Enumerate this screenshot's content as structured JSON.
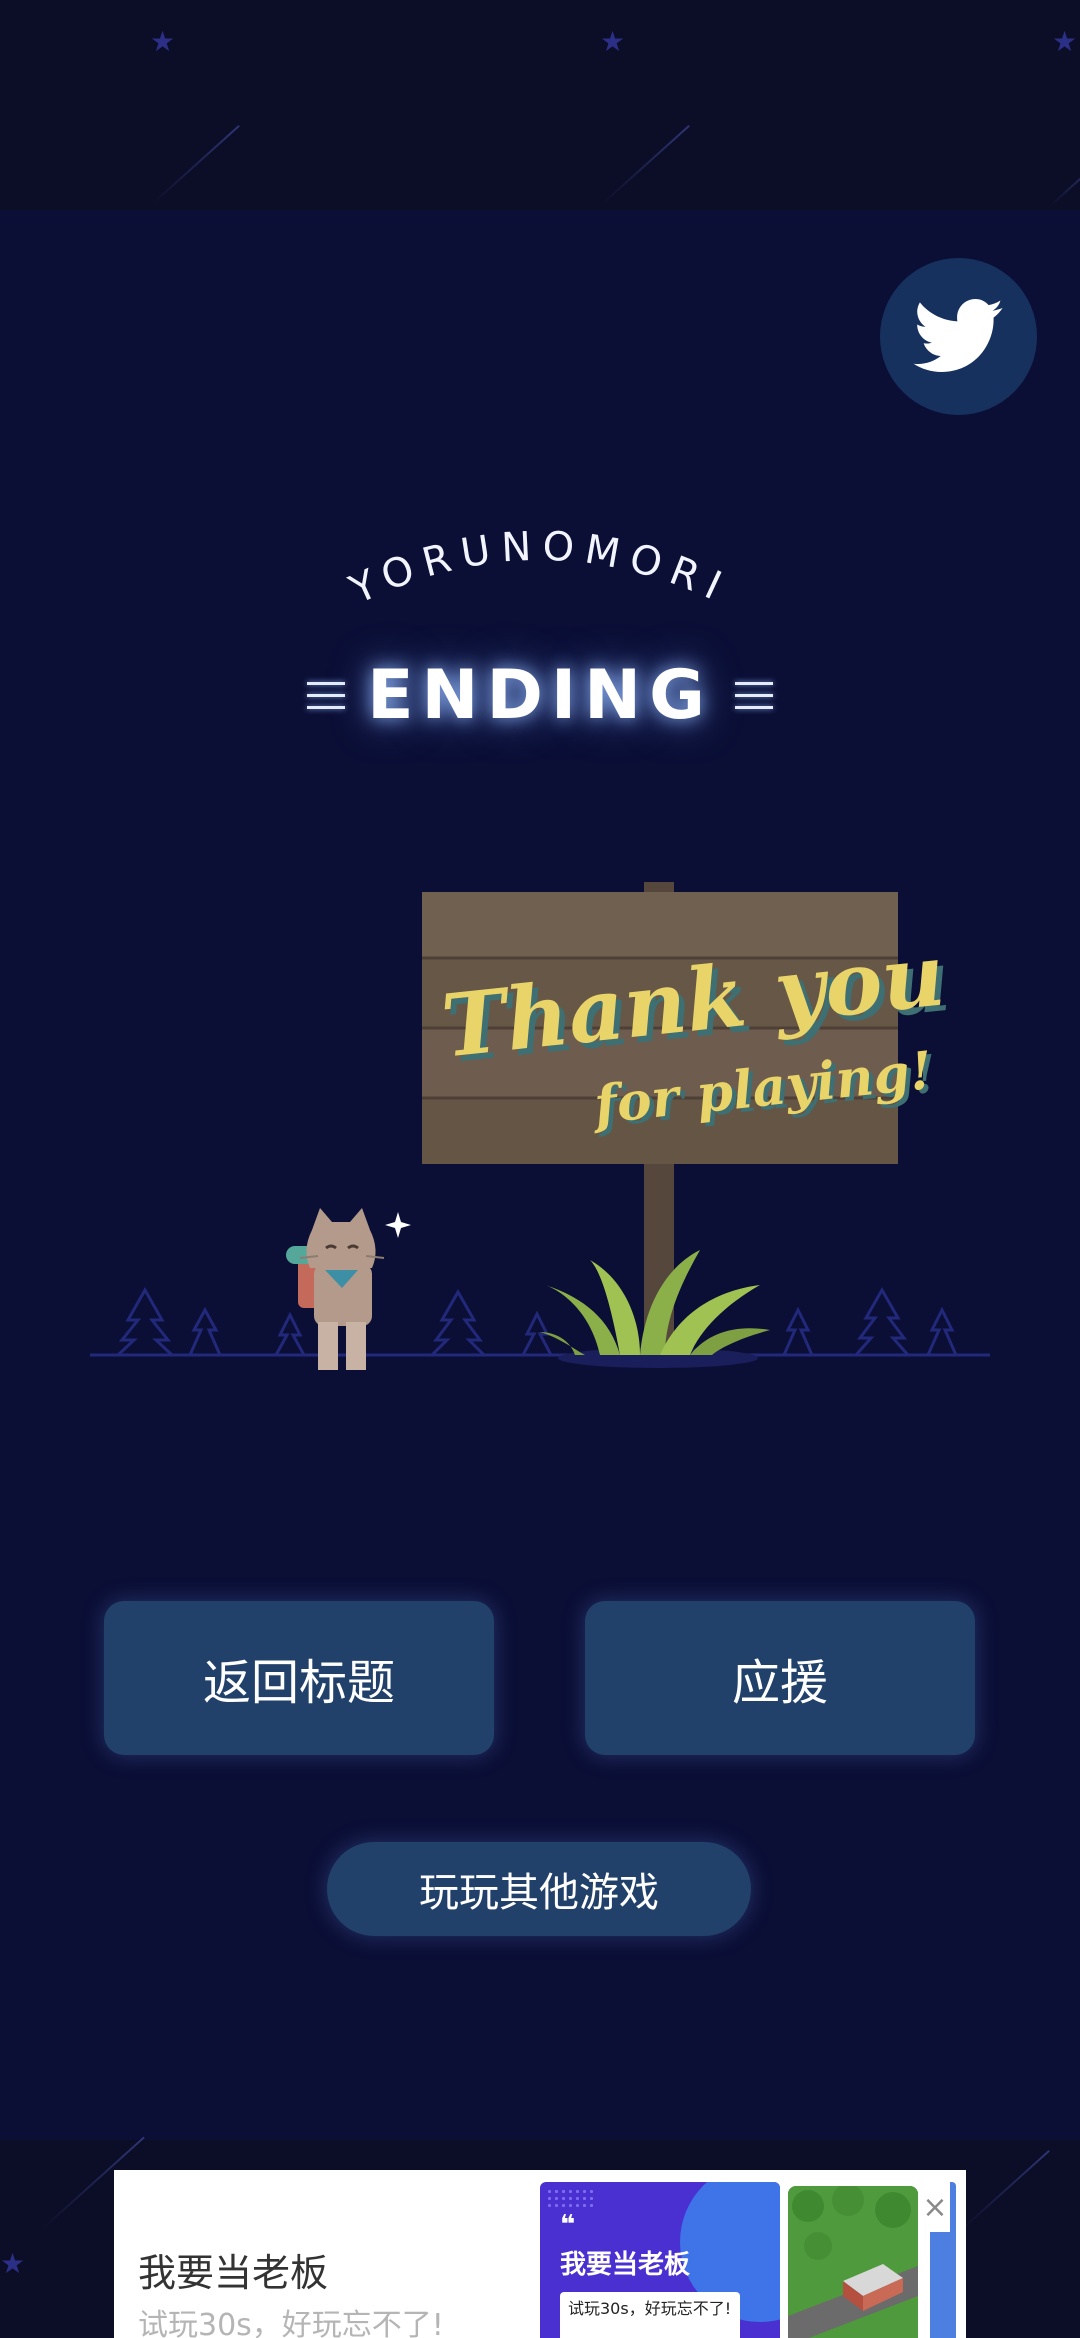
{
  "game": {
    "brand": "YORUNOMORI",
    "ending_title": "ENDING",
    "sign_line1": "Thank you",
    "sign_line2": "for playing!"
  },
  "buttons": {
    "return_title": "返回标题",
    "support": "应援",
    "other_games": "玩玩其他游戏"
  },
  "ad": {
    "title": "我要当老板",
    "subtitle": "试玩30s，好玩忘不了!",
    "card_quote": "❝",
    "card_title": "我要当老板",
    "card_text": "试玩30s，好玩忘不了!",
    "close_glyph": "×"
  },
  "icons": {
    "share": "twitter-icon",
    "close": "close-icon"
  },
  "colors": {
    "background": "#0b0f36",
    "button": "#21406a",
    "sign_text": "#e9d46a",
    "sign_wood": "#6b5a4c"
  }
}
